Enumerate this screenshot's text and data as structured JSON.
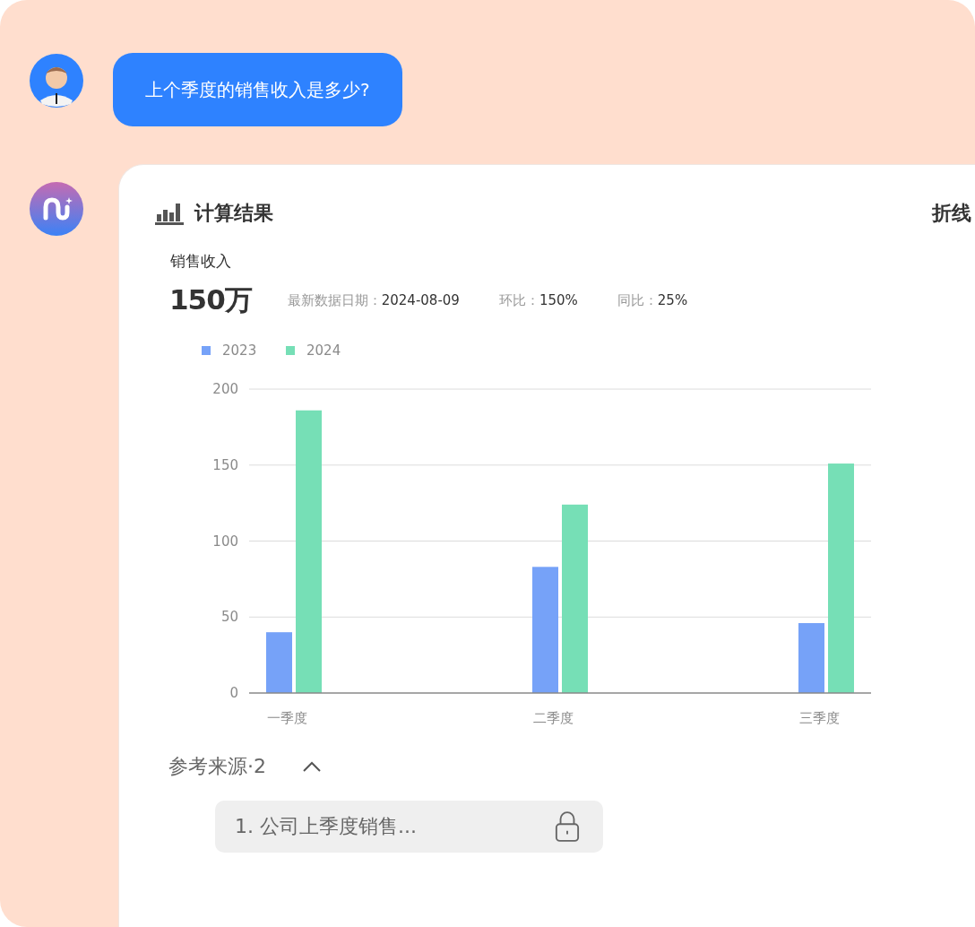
{
  "user_message": {
    "text": "上个季度的销售收入是多少?"
  },
  "result_card": {
    "title": "计算结果",
    "chart_switch": "折线",
    "metric": {
      "label": "销售收入",
      "value": "150万",
      "stats": [
        {
          "label": "最新数据日期：",
          "value": "2024-08-09"
        },
        {
          "label": "环比：",
          "value": "150%"
        },
        {
          "label": "同比：",
          "value": "25%"
        }
      ]
    },
    "chart_data": {
      "type": "bar",
      "categories": [
        "一季度",
        "二季度",
        "三季度"
      ],
      "series": [
        {
          "name": "2023",
          "color": "#76a2f8",
          "values": [
            40,
            83,
            46
          ]
        },
        {
          "name": "2024",
          "color": "#76dfb6",
          "values": [
            186,
            124,
            151
          ]
        }
      ],
      "grid": true,
      "legend": true,
      "ylim": [
        0,
        200
      ],
      "yticks": [
        0,
        50,
        100,
        150,
        200
      ]
    },
    "sources": {
      "label": "参考来源·2",
      "expanded": true,
      "items": [
        {
          "text": "1. 公司上季度销售...",
          "locked": true
        }
      ]
    }
  }
}
